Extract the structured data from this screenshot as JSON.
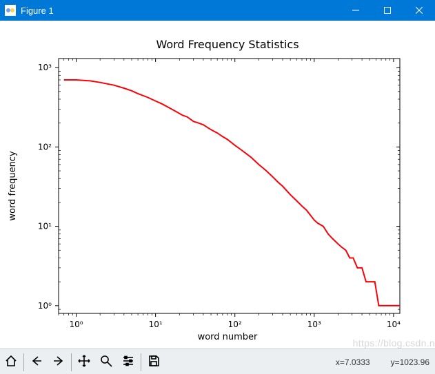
{
  "window": {
    "title": "Figure 1"
  },
  "chart_data": {
    "type": "line",
    "title": "Word Frequency Statistics",
    "xlabel": "word number",
    "ylabel": "word frequency",
    "xscale": "log",
    "yscale": "log",
    "xlim": [
      0.6,
      12000
    ],
    "ylim": [
      0.8,
      1300
    ],
    "xticks": [
      {
        "value": 1,
        "label": "10⁰"
      },
      {
        "value": 10,
        "label": "10¹"
      },
      {
        "value": 100,
        "label": "10²"
      },
      {
        "value": 1000,
        "label": "10³"
      },
      {
        "value": 10000,
        "label": "10⁴"
      }
    ],
    "yticks": [
      {
        "value": 1,
        "label": "10⁰"
      },
      {
        "value": 10,
        "label": "10¹"
      },
      {
        "value": 100,
        "label": "10²"
      },
      {
        "value": 1000,
        "label": "10³"
      }
    ],
    "series": [
      {
        "name": "word frequency",
        "color": "#fb0007",
        "x": [
          0.7,
          1,
          1.5,
          2,
          3,
          4,
          5,
          6,
          8,
          10,
          12,
          15,
          18,
          22,
          25,
          30,
          35,
          40,
          50,
          60,
          70,
          80,
          100,
          120,
          140,
          160,
          200,
          250,
          300,
          350,
          400,
          500,
          600,
          700,
          800,
          1000,
          1100,
          1300,
          1500,
          1700,
          2000,
          2200,
          2500,
          2800,
          3100,
          3500,
          4000,
          4500,
          5200,
          5800,
          6500,
          12000
        ],
        "y": [
          700,
          700,
          680,
          650,
          600,
          550,
          510,
          470,
          420,
          380,
          350,
          310,
          280,
          250,
          240,
          210,
          200,
          190,
          165,
          150,
          135,
          125,
          105,
          92,
          82,
          74,
          60,
          50,
          42,
          36,
          32,
          25,
          21,
          18,
          16,
          12,
          11,
          10,
          8,
          7,
          6,
          5.5,
          5,
          4,
          4,
          3,
          3,
          2,
          2,
          2,
          1,
          1
        ]
      }
    ]
  },
  "toolbar": {
    "items": [
      {
        "name": "home-icon",
        "tip": "Reset original view"
      },
      {
        "name": "back-icon",
        "tip": "Back"
      },
      {
        "name": "forward-icon",
        "tip": "Forward"
      },
      {
        "name": "move-icon",
        "tip": "Pan"
      },
      {
        "name": "zoom-icon",
        "tip": "Zoom"
      },
      {
        "name": "config-icon",
        "tip": "Configure subplots"
      },
      {
        "name": "save-icon",
        "tip": "Save"
      }
    ],
    "coord_x_label": "x=",
    "coord_x_value": "7.0333",
    "coord_y_label": "y=",
    "coord_y_value": "1023.96"
  },
  "watermark": "https://blog.csdn.n"
}
